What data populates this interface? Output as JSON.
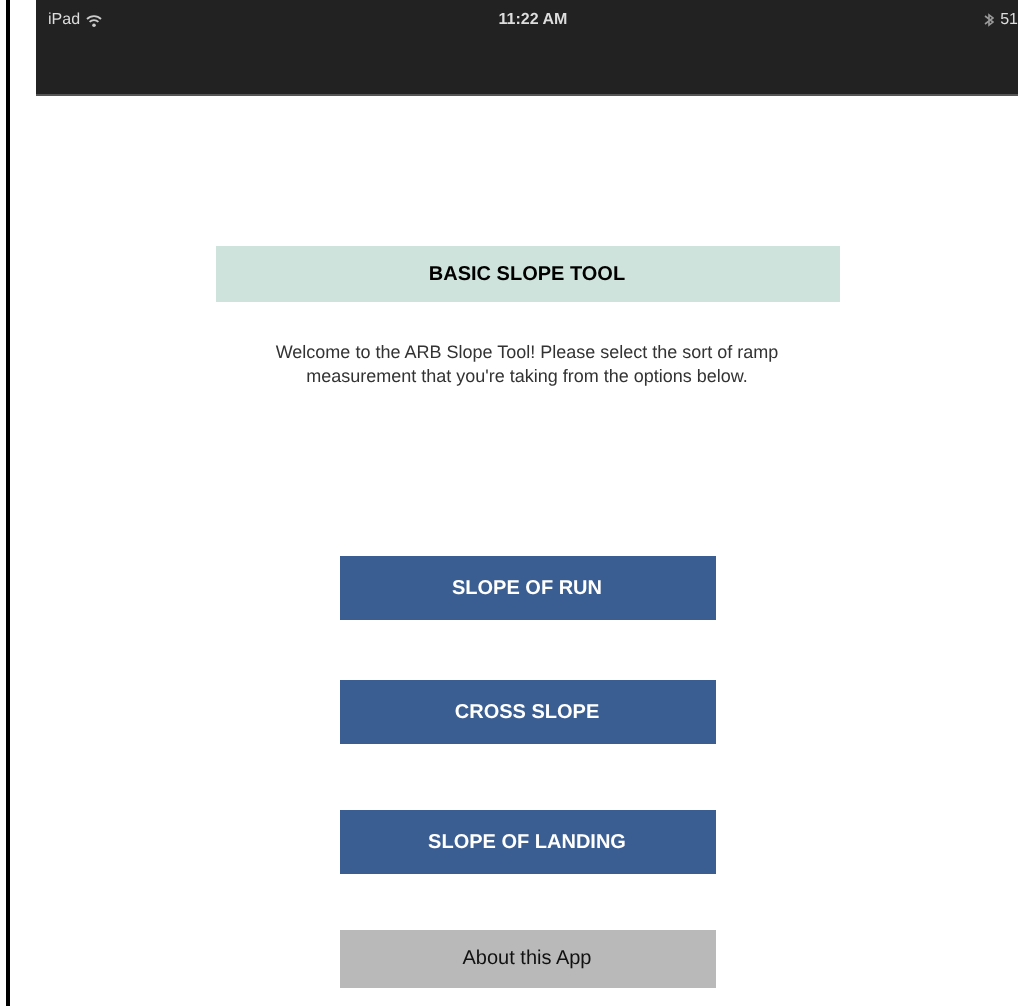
{
  "status_bar": {
    "device": "iPad",
    "time": "11:22 AM",
    "battery": "51"
  },
  "title": "BASIC SLOPE TOOL",
  "intro": "Welcome to the ARB Slope Tool!  Please select the sort of ramp measurement that you're taking from the options below.",
  "buttons": [
    {
      "label": "SLOPE OF RUN",
      "kind": "primary"
    },
    {
      "label": "CROSS SLOPE",
      "kind": "primary"
    },
    {
      "label": "SLOPE OF LANDING",
      "kind": "primary"
    },
    {
      "label": "About this App",
      "kind": "secondary"
    }
  ]
}
